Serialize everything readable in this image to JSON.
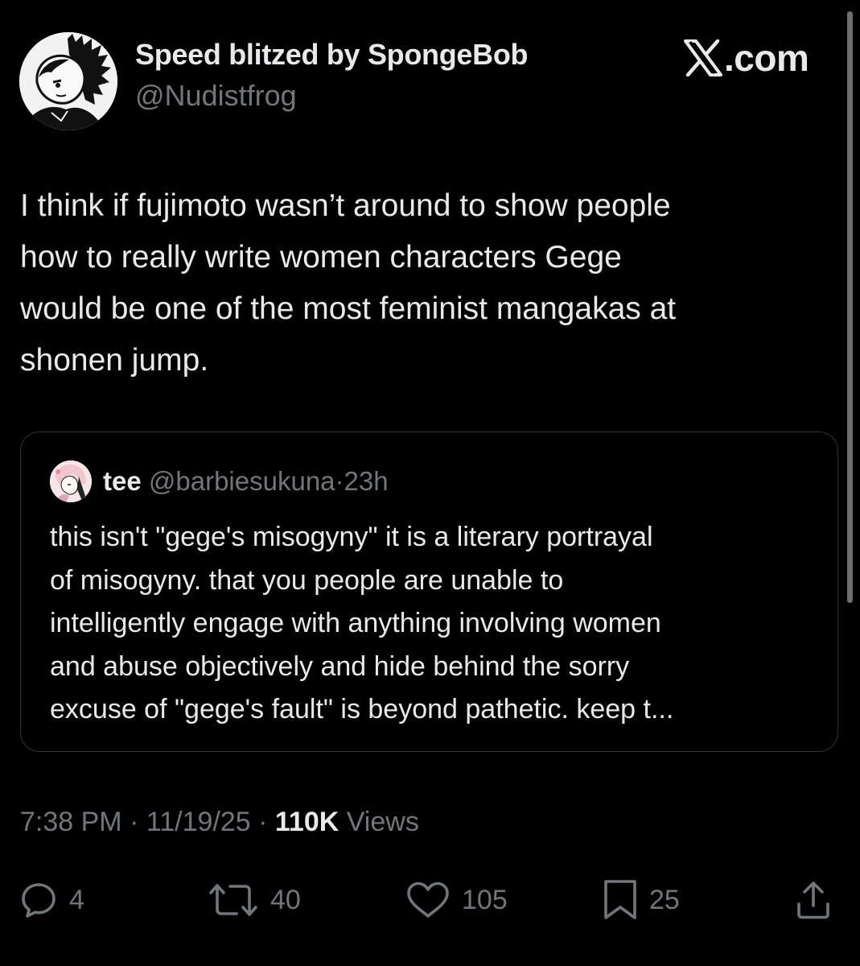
{
  "author": {
    "display_name": "Speed blitzed by SpongeBob",
    "handle": "@Nudistfrog",
    "avatar_icon": "manga-character-avatar"
  },
  "brand": {
    "logo_icon": "x-logo-icon",
    "text": ".com"
  },
  "tweet": {
    "text": "I think if fujimoto wasn’t around to show people\nhow to really write women characters Gege\nwould be one of the most feminist mangakas at\nshonen jump."
  },
  "quote": {
    "name": "tee",
    "handle": "@barbiesukuna",
    "separator": "·",
    "time": "23h",
    "avatar_icon": "anime-character-avatar",
    "text": "this isn't \"gege's misogyny\" it is a literary portrayal\nof misogyny. that you people are unable to\nintelligently engage with anything involving women\nand abuse objectively and hide behind the sorry\nexcuse of \"gege's fault\" is beyond pathetic. keep t..."
  },
  "meta": {
    "time": "7:38 PM",
    "separator1": " · ",
    "date": "11/19/25",
    "separator2": " · ",
    "views_count": "110K",
    "views_label": " Views"
  },
  "actions": {
    "replies": "4",
    "reposts": "40",
    "likes": "105",
    "bookmarks": "25"
  },
  "colors": {
    "background": "#000000",
    "primary_text": "#e7e9ea",
    "secondary_text": "#71767b",
    "border": "#2f3336"
  }
}
